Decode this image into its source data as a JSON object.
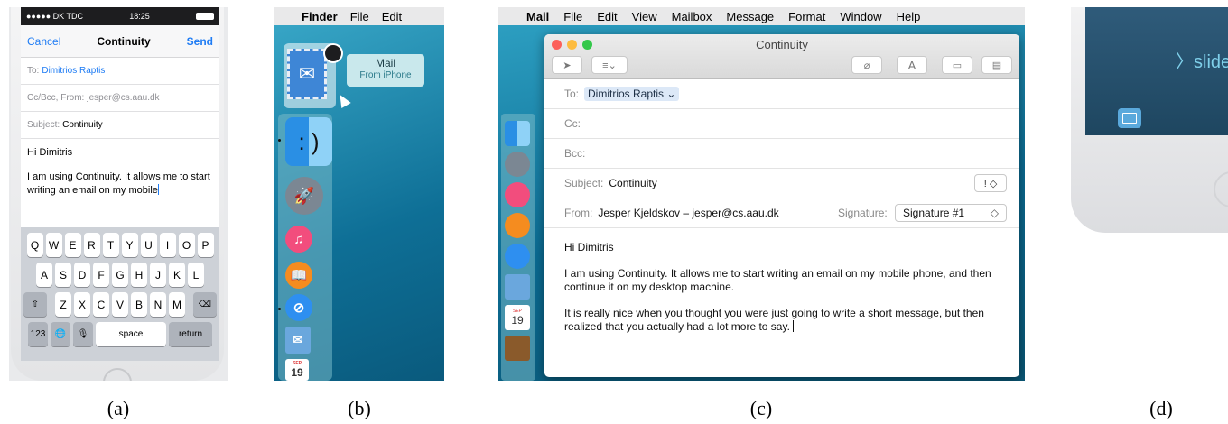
{
  "captions": {
    "a": "(a)",
    "b": "(b)",
    "c": "(c)",
    "d": "(d)"
  },
  "iphone": {
    "status": {
      "carrier": "●●●●● DK TDC",
      "time": "18:25"
    },
    "nav": {
      "cancel": "Cancel",
      "title": "Continuity",
      "send": "Send"
    },
    "to_label": "To:",
    "to_value": "Dimitrios Raptis",
    "ccbcc_label": "Cc/Bcc, From:",
    "ccbcc_value": "jesper@cs.aau.dk",
    "subject_label": "Subject:",
    "subject_value": "Continuity",
    "greeting": "Hi Dimitris",
    "body": "I am using Continuity. It allows me to start writing an email on my mobile",
    "keyboard": {
      "row1": [
        "Q",
        "W",
        "E",
        "R",
        "T",
        "Y",
        "U",
        "I",
        "O",
        "P"
      ],
      "row2": [
        "A",
        "S",
        "D",
        "F",
        "G",
        "H",
        "J",
        "K",
        "L"
      ],
      "row3": [
        "Z",
        "X",
        "C",
        "V",
        "B",
        "N",
        "M"
      ],
      "shift": "⇧",
      "delete": "⌫",
      "numbers": "123",
      "globe": "🌐",
      "mic": "🎙",
      "space": "space",
      "return": "return"
    }
  },
  "finder": {
    "menu": {
      "apple": "",
      "app": "Finder",
      "file": "File",
      "edit": "Edit"
    },
    "handoff_tooltip": {
      "title": "Mail",
      "subtitle": "From iPhone"
    },
    "finder_face": ": )",
    "calendar_month": "SEP",
    "calendar_day": "19"
  },
  "mail": {
    "menu": {
      "apple": "",
      "app": "Mail",
      "items": [
        "File",
        "Edit",
        "View",
        "Mailbox",
        "Message",
        "Format",
        "Window",
        "Help"
      ]
    },
    "window_title": "Continuity",
    "toolbar": {
      "send": "➤",
      "list": "≡⌄",
      "attach": "⌀",
      "font": "A",
      "window": "▭",
      "template": "▤"
    },
    "to_label": "To:",
    "to_value": "Dimitrios Raptis ⌄",
    "cc_label": "Cc:",
    "bcc_label": "Bcc:",
    "subject_label": "Subject:",
    "subject_value": "Continuity",
    "priority": "! ◇",
    "from_label": "From:",
    "from_value": "Jesper Kjeldskov – jesper@cs.aau.dk",
    "signature_label": "Signature:",
    "signature_value": "Signature #1",
    "signature_arrow": "◇",
    "greeting": "Hi Dimitris",
    "para1": "I am using Continuity. It allows me to start writing an email on my mobile phone, and then continue it on my desktop machine.",
    "para2": "It is really nice when you thought you were just going to write a short message, but then realized that you actually had a lot more to say.",
    "calendar_month": "SEP",
    "calendar_day": "19"
  },
  "lockscreen": {
    "slide": "〉slide"
  }
}
